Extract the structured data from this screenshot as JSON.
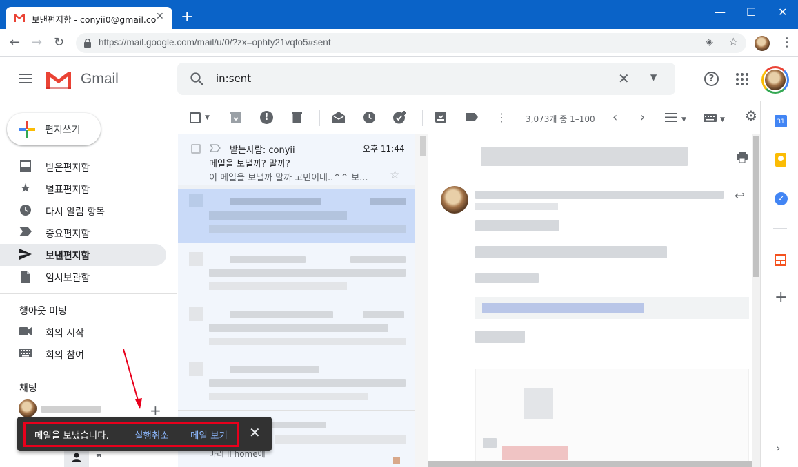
{
  "browser": {
    "tab_title": "보낸편지함 - conyii0@gmail.com",
    "tab_close": "✕",
    "new_tab": "+",
    "url": "https://mail.google.com/mail/u/0/?zx=ophty21vqfo5#sent",
    "window_controls": [
      "—",
      "☐",
      "✕"
    ]
  },
  "header": {
    "app_name": "Gmail",
    "search_value": "in:sent",
    "accent_red": "#ea4335"
  },
  "compose": {
    "label": "편지쓰기"
  },
  "nav": {
    "items": [
      {
        "label": "받은편지함",
        "icon": "inbox-icon"
      },
      {
        "label": "별표편지함",
        "icon": "star-icon"
      },
      {
        "label": "다시 알림 항목",
        "icon": "clock-icon"
      },
      {
        "label": "중요편지함",
        "icon": "label-important-icon"
      },
      {
        "label": "보낸편지함",
        "icon": "send-icon",
        "active": true
      },
      {
        "label": "임시보관함",
        "icon": "draft-icon"
      }
    ],
    "meet_title": "행아웃 미팅",
    "meet_items": [
      {
        "label": "회의 시작",
        "icon": "video-icon"
      },
      {
        "label": "회의 참여",
        "icon": "keyboard-icon"
      }
    ],
    "chat_title": "채팅"
  },
  "toolbar": {
    "page_count": "3,073개 중 1–100"
  },
  "mail_list": {
    "first": {
      "to": "받는사람: conyii",
      "time": "오후 11:44",
      "subject": "메일을 보낼까? 말까?",
      "snippet": "이 메일을 보낼까 말까 고민이네..^^ 보..."
    },
    "bottom_fragment": "마리 Il home에"
  },
  "snackbar": {
    "message": "메일을 보냈습니다.",
    "undo": "실행취소",
    "view": "메일 보기",
    "close": "✕"
  }
}
